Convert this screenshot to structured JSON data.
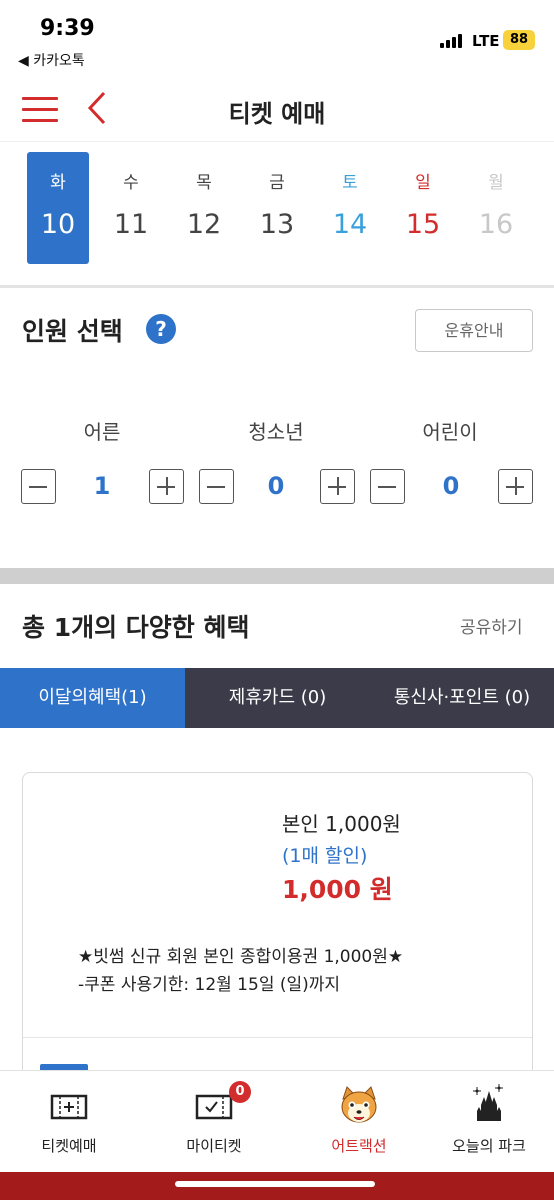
{
  "status_bar": {
    "time": "9:39",
    "back_app": "◀ 카카오톡",
    "network": "LTE",
    "battery": "88"
  },
  "header": {
    "title": "티켓 예매"
  },
  "dates": [
    {
      "dow": "화",
      "day": "10",
      "color": "#ffffff",
      "selected": true
    },
    {
      "dow": "수",
      "day": "11",
      "color": "#444444"
    },
    {
      "dow": "목",
      "day": "12",
      "color": "#444444"
    },
    {
      "dow": "금",
      "day": "13",
      "color": "#444444"
    },
    {
      "dow": "토",
      "day": "14",
      "color": "#3aa0dc"
    },
    {
      "dow": "일",
      "day": "15",
      "color": "#d22c2c"
    },
    {
      "dow": "월",
      "day": "16",
      "color": "#c8c8c8"
    }
  ],
  "persons": {
    "title": "인원 선택",
    "help_icon": "?",
    "rest_button": "운휴안내",
    "groups": [
      {
        "label": "어른",
        "count": "1"
      },
      {
        "label": "청소년",
        "count": "0"
      },
      {
        "label": "어린이",
        "count": "0"
      }
    ]
  },
  "benefits": {
    "title": "총 1개의 다양한 혜택",
    "share": "공유하기",
    "tabs": [
      "이달의혜택(1)",
      "제휴카드 (0)",
      "통신사·포인트 (0)"
    ],
    "card": {
      "price_title": "본인 1,000원",
      "price_note": "(1매 할인)",
      "price_amount": "1,000 원",
      "desc1": "★빗썸 신규 회원 본인 종합이용권 1,000원★",
      "desc2": "-쿠폰 사용기한: 12월 15일 (일)까지"
    }
  },
  "bottom_nav": [
    {
      "label": "티켓예매",
      "icon": "ticket-icon"
    },
    {
      "label": "마이티켓",
      "icon": "my-ticket-icon",
      "badge": "0"
    },
    {
      "label": "어트랙션",
      "icon": "raccoon-mascot-icon"
    },
    {
      "label": "오늘의 파크",
      "icon": "castle-fireworks-icon"
    }
  ],
  "colors": {
    "accent_red": "#d22c2c",
    "accent_blue": "#2e73c9",
    "tab_bar": "#3b3b4a",
    "bottom_bar": "#a41b1b"
  }
}
